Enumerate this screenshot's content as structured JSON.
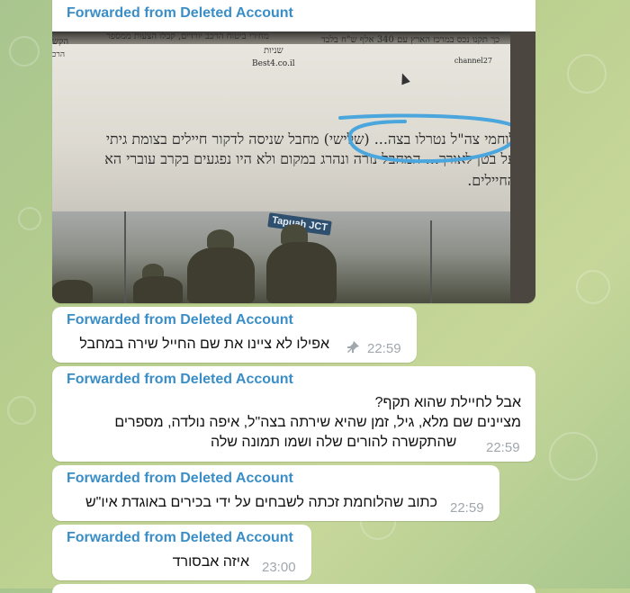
{
  "colors": {
    "accent": "#3a8ec7",
    "bubble": "#ffffff",
    "time": "#a0a7ad",
    "annotation": "#4aa6dd"
  },
  "messages": [
    {
      "forwarded": "Forwarded from Deleted Account",
      "photo": {
        "header_right": "כך תקנו נכס במרכז הארץ עם 340 אלף ש\"ח בלבד",
        "source_right": "channel27",
        "header_mid": "מחירי ביטוח הרכב יורדים, קבלו הצעות ממספר",
        "header_mid2": "שניות",
        "source_mid": "Best4.co.il",
        "header_left": "הקש",
        "header_left2": "הרכ",
        "line1": "לוחמי צה\"ל נטרלו בצה... (שלישי) מחבל שניסה לדקור חיילים בצומת גיתי",
        "line2": "על בטן לאורך... המחבל נורה ונהרג במקום ולא היו נפגעים בקרב עוברי הא",
        "line3": "החיילים.",
        "side_fragment": "כך",
        "road_sign": "Tapuah JCT"
      }
    },
    {
      "forwarded": "Forwarded from Deleted Account",
      "lines": [
        "אפילו לא ציינו את שם החייל שירה במחבל"
      ],
      "time": "22:59",
      "icon": "pin-icon"
    },
    {
      "forwarded": "Forwarded from Deleted Account",
      "lines": [
        "אבל לחיילת שהוא תקף?",
        "מציינים שם מלא, גיל, זמן שהיא שירתה בצה\"ל, איפה נולדה, מספרים",
        "שהתקשרה להורים שלה ושמו תמונה שלה"
      ],
      "time": "22:59"
    },
    {
      "forwarded": "Forwarded from Deleted Account",
      "lines": [
        "כתוב שהלוחמת זכתה לשבחים על ידי בכירים באוגדת איו\"ש"
      ],
      "time": "22:59"
    },
    {
      "forwarded": "Forwarded from Deleted Account",
      "lines": [
        "איזה אבסורד"
      ],
      "time": "23:00"
    }
  ]
}
